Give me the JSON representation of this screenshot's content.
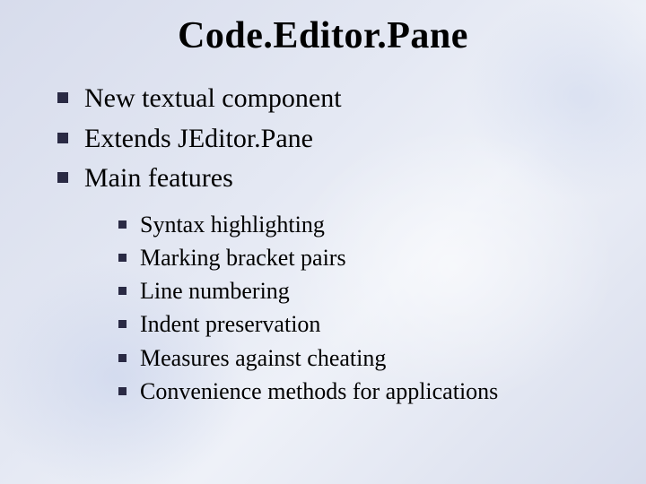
{
  "title": "Code.Editor.Pane",
  "bullets": [
    "New textual component",
    "Extends JEditor.Pane",
    "Main features"
  ],
  "sub_bullets": [
    "Syntax highlighting",
    "Marking bracket pairs",
    "Line numbering",
    "Indent preservation",
    "Measures against cheating",
    "Convenience methods for applications"
  ]
}
